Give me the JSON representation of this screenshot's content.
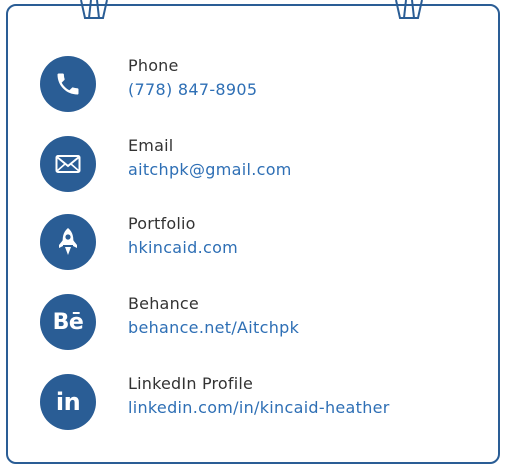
{
  "accent_color": "#2a5d95",
  "link_color": "#2e6fb5",
  "contacts": [
    {
      "icon": "phone-icon",
      "label": "Phone",
      "value": "(778) 847-8905"
    },
    {
      "icon": "email-icon",
      "label": "Email",
      "value": "aitchpk@gmail.com"
    },
    {
      "icon": "rocket-icon",
      "label": "Portfolio",
      "value": "hkincaid.com"
    },
    {
      "icon": "behance-icon",
      "label": "Behance",
      "value": "behance.net/Aitchpk",
      "icon_text": "Bē"
    },
    {
      "icon": "linkedin-icon",
      "label": "LinkedIn Profile",
      "value": "linkedin.com/in/kincaid-heather",
      "icon_text": "in"
    }
  ]
}
